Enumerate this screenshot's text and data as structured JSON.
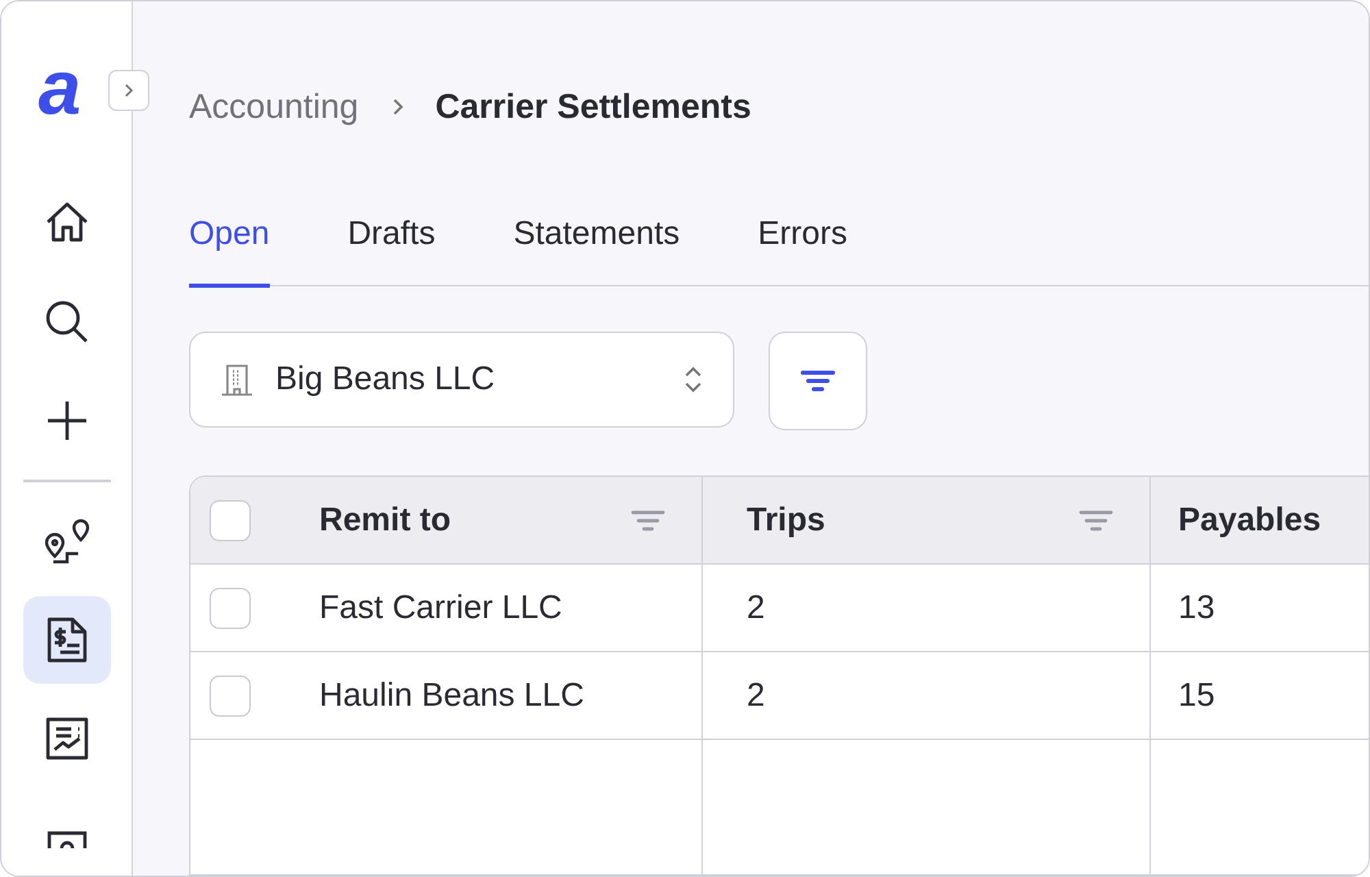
{
  "sidebar": {
    "logo": "a",
    "nav_top": [
      {
        "kind": "home",
        "selected": false
      },
      {
        "kind": "search",
        "selected": false
      },
      {
        "kind": "add",
        "selected": false
      }
    ],
    "nav": [
      {
        "kind": "route",
        "selected": false
      },
      {
        "kind": "invoice",
        "selected": true
      },
      {
        "kind": "report",
        "selected": false
      },
      {
        "kind": "cut",
        "selected": false
      }
    ]
  },
  "breadcrumb": [
    "Accounting",
    "Carrier Settlements"
  ],
  "tabs": [
    {
      "label": "Open",
      "selected": true
    },
    {
      "label": "Drafts",
      "selected": false
    },
    {
      "label": "Statements",
      "selected": false
    },
    {
      "label": "Errors",
      "selected": false
    }
  ],
  "company_select": {
    "value": "Big Beans LLC"
  },
  "table": {
    "header_checked": false,
    "columns": [
      {
        "label": "Remit to",
        "filter": true
      },
      {
        "label": "Trips",
        "filter": true
      },
      {
        "label": "Payables"
      }
    ],
    "rows": [
      {
        "checked": false,
        "cells": [
          "Fast Carrier LLC",
          "2",
          "13"
        ]
      },
      {
        "checked": false,
        "cells": [
          "Haulin Beans LLC",
          "2",
          "15"
        ]
      }
    ]
  }
}
